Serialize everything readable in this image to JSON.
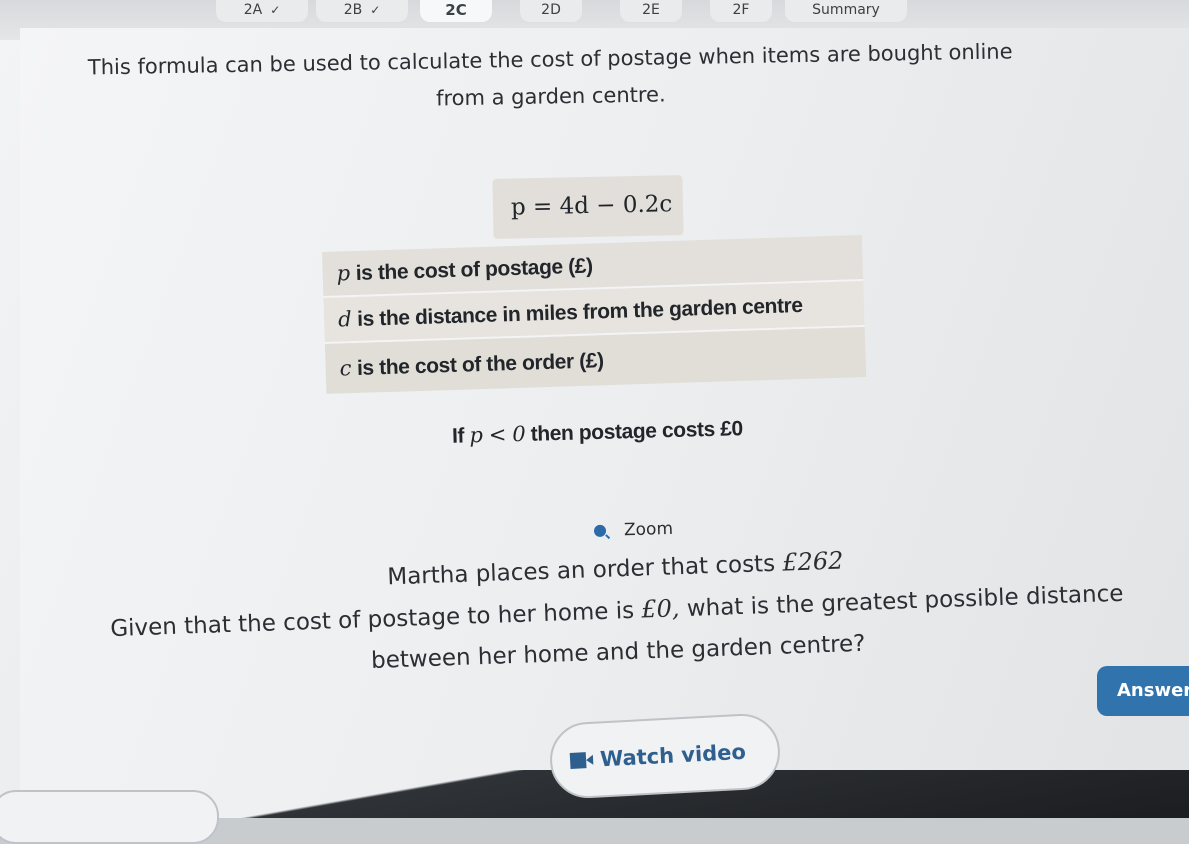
{
  "tabs": [
    {
      "label": "2A",
      "completed": true
    },
    {
      "label": "2B",
      "completed": true
    },
    {
      "label": "2C",
      "completed": false,
      "active": true
    },
    {
      "label": "2D",
      "completed": false
    },
    {
      "label": "2E",
      "completed": false
    },
    {
      "label": "2F",
      "completed": false
    },
    {
      "label": "Summary",
      "completed": false
    }
  ],
  "icons": {
    "check": "check-icon",
    "zoom": "zoom-icon",
    "video": "video-icon"
  },
  "question": {
    "intro": "This formula can be used to calculate the cost of postage when items are bought online from a garden centre.",
    "formula": "p = 4d − 0.2c",
    "definitions": [
      {
        "var": "p",
        "text": "is the cost of postage (£)"
      },
      {
        "var": "d",
        "text": "is the distance in miles from the garden centre"
      },
      {
        "var": "c",
        "text": "is the cost of the order (£)"
      }
    ],
    "note_prefix": "If",
    "note_math": "p < 0",
    "note_suffix": "then postage costs £0",
    "zoom_label": "Zoom",
    "line1_text": "Martha places an order that costs",
    "line1_math": "£262",
    "line2_text": "Given that the cost of postage to her home is",
    "line2_math": "£0,",
    "line2_rest": "what is the greatest possible distance between her home and the garden centre?"
  },
  "buttons": {
    "answer": "Answer",
    "watch_video": "Watch video"
  },
  "colors": {
    "accent": "#3173ad",
    "video_text": "#2f5f8f"
  }
}
